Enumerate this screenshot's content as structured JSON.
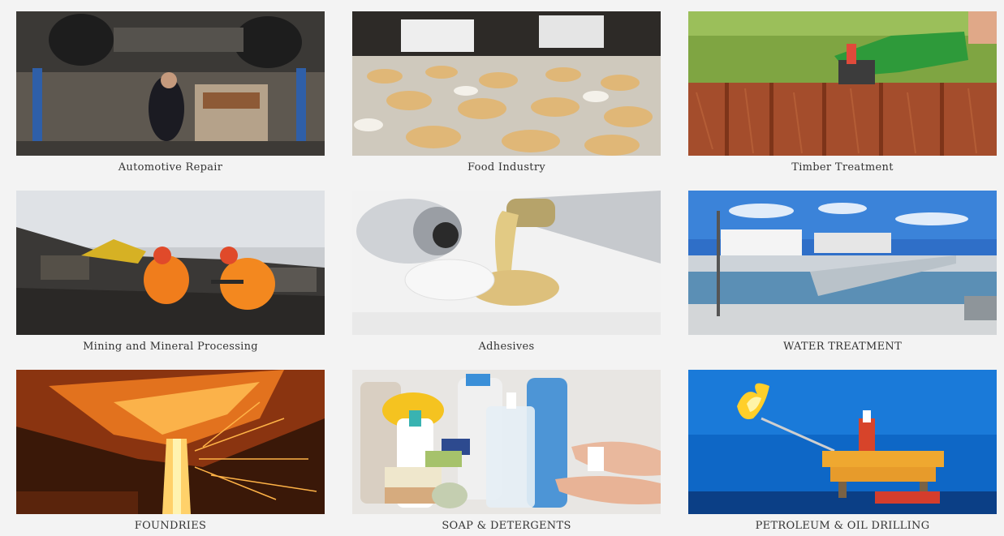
{
  "industries": [
    {
      "label": "Automotive Repair"
    },
    {
      "label": "Food Industry"
    },
    {
      "label": "Timber Treatment"
    },
    {
      "label": "Mining and Mineral Processing"
    },
    {
      "label": "Adhesives"
    },
    {
      "label": "WATER TREATMENT"
    },
    {
      "label": "FOUNDRIES"
    },
    {
      "label": "SOAP & DETERGENTS"
    },
    {
      "label": "PETROLEUM & OIL DRILLING"
    }
  ]
}
